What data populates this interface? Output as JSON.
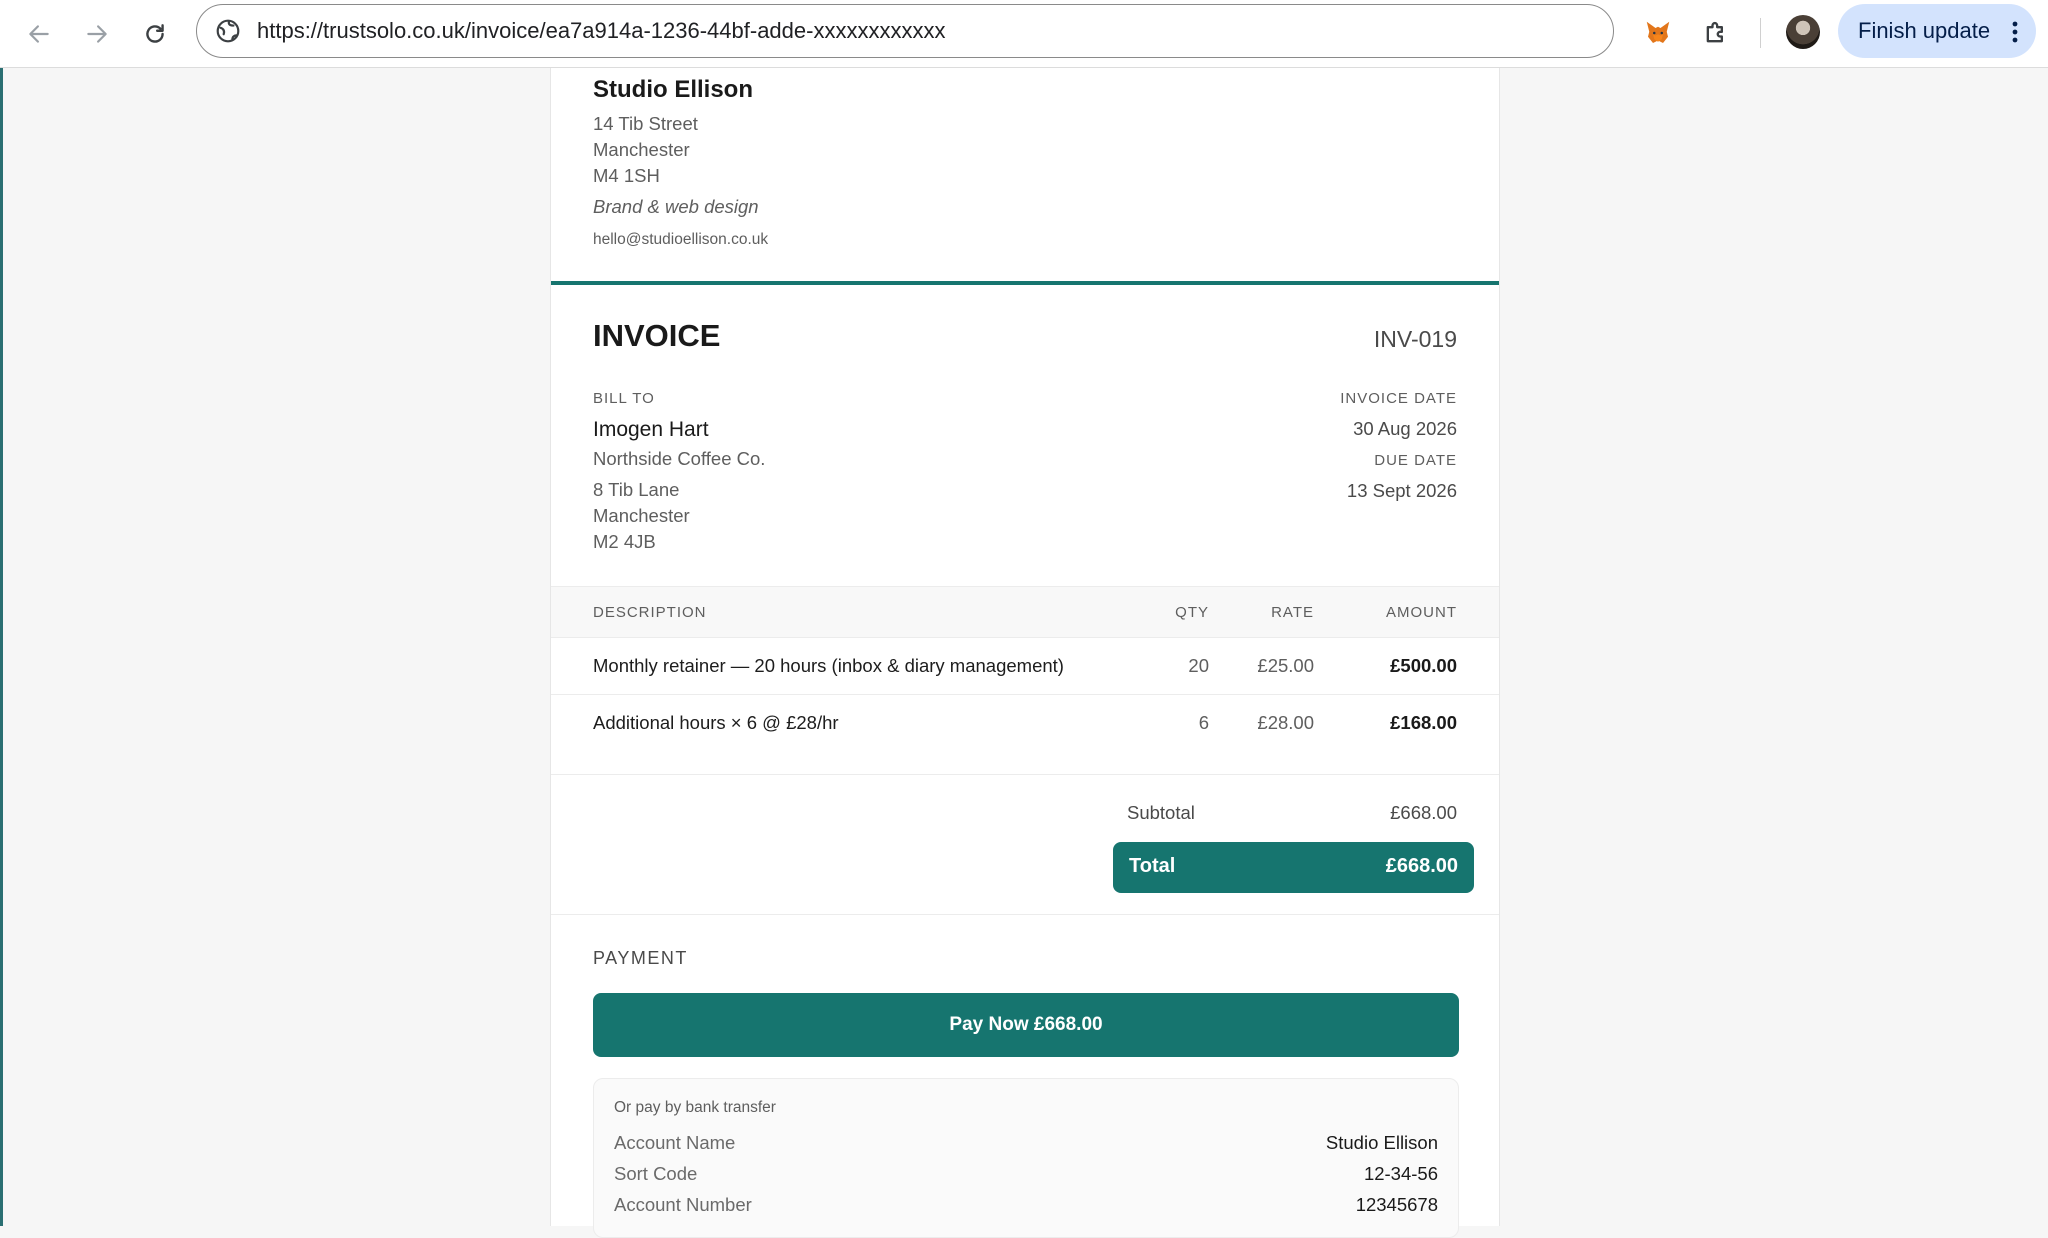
{
  "browser": {
    "url": "https://trustsolo.co.uk/invoice/ea7a914a-1236-44bf-adde-xxxxxxxxxxxx",
    "finish_update_label": "Finish update"
  },
  "business": {
    "name": "Studio Ellison",
    "address": [
      "14 Tib Street",
      "Manchester",
      "M4 1SH"
    ],
    "tagline": "Brand & web design",
    "email": "hello@studioellison.co.uk"
  },
  "invoice": {
    "title": "INVOICE",
    "number": "INV-019",
    "bill_to_label": "BILL TO",
    "client_name": "Imogen Hart",
    "client_company": "Northside Coffee Co.",
    "client_address": [
      "8 Tib Lane",
      "Manchester",
      "M2 4JB"
    ],
    "invoice_date_label": "INVOICE DATE",
    "invoice_date": "30 Aug 2026",
    "due_date_label": "DUE DATE",
    "due_date": "13 Sept 2026"
  },
  "table": {
    "headers": {
      "description": "DESCRIPTION",
      "qty": "QTY",
      "rate": "RATE",
      "amount": "AMOUNT"
    },
    "rows": [
      {
        "description": "Monthly retainer — 20 hours (inbox & diary management)",
        "qty": "20",
        "rate": "£25.00",
        "amount": "£500.00"
      },
      {
        "description": "Additional hours × 6 @ £28/hr",
        "qty": "6",
        "rate": "£28.00",
        "amount": "£168.00"
      }
    ]
  },
  "totals": {
    "subtotal_label": "Subtotal",
    "subtotal": "£668.00",
    "total_label": "Total",
    "total": "£668.00"
  },
  "payment": {
    "label": "PAYMENT",
    "pay_now_label": "Pay Now £668.00",
    "bank_intro": "Or pay by bank transfer",
    "bank_details": [
      {
        "key": "Account Name",
        "value": "Studio Ellison"
      },
      {
        "key": "Sort Code",
        "value": "12-34-56"
      },
      {
        "key": "Account Number",
        "value": "12345678"
      }
    ]
  },
  "colors": {
    "accent": "#16756f",
    "update_chip": "#d3e3fd"
  }
}
